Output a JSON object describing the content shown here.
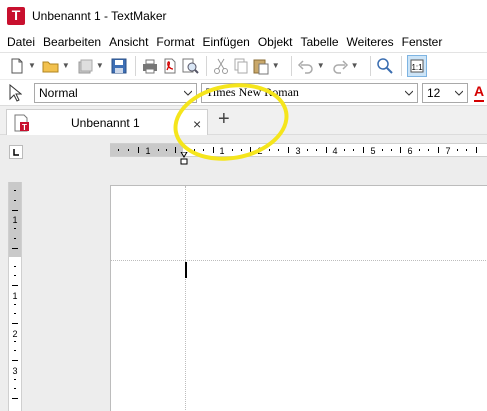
{
  "window": {
    "title": "Unbenannt 1 - TextMaker",
    "app_icon_letter": "T"
  },
  "menu": [
    "Datei",
    "Bearbeiten",
    "Ansicht",
    "Format",
    "Einfügen",
    "Objekt",
    "Tabelle",
    "Weiteres",
    "Fenster"
  ],
  "toolbar": {
    "icons": [
      "new-document-icon",
      "open-folder-icon",
      "save-all-icon",
      "save-icon",
      "print-icon",
      "export-pdf-icon",
      "print-preview-icon",
      "cut-icon",
      "copy-icon",
      "paste-icon",
      "undo-icon",
      "redo-icon",
      "search-icon",
      "view-mode-icon"
    ]
  },
  "formatbar": {
    "style_value": "Normal",
    "font_value": "Times New Roman",
    "size_value": "12",
    "font_color_letter": "A",
    "font_color": "#d40000"
  },
  "tabs": [
    {
      "label": "Unbenannt 1",
      "close": "×"
    }
  ],
  "add_tab_symbol": "+",
  "ruler": {
    "h_labels": [
      "1",
      "1",
      "2",
      "3",
      "4",
      "5",
      "6",
      "7"
    ],
    "v_labels": [
      "1",
      "1",
      "2",
      "3"
    ]
  },
  "colors": {
    "highlight": "#f5e51c",
    "accent_red": "#c8102e"
  }
}
